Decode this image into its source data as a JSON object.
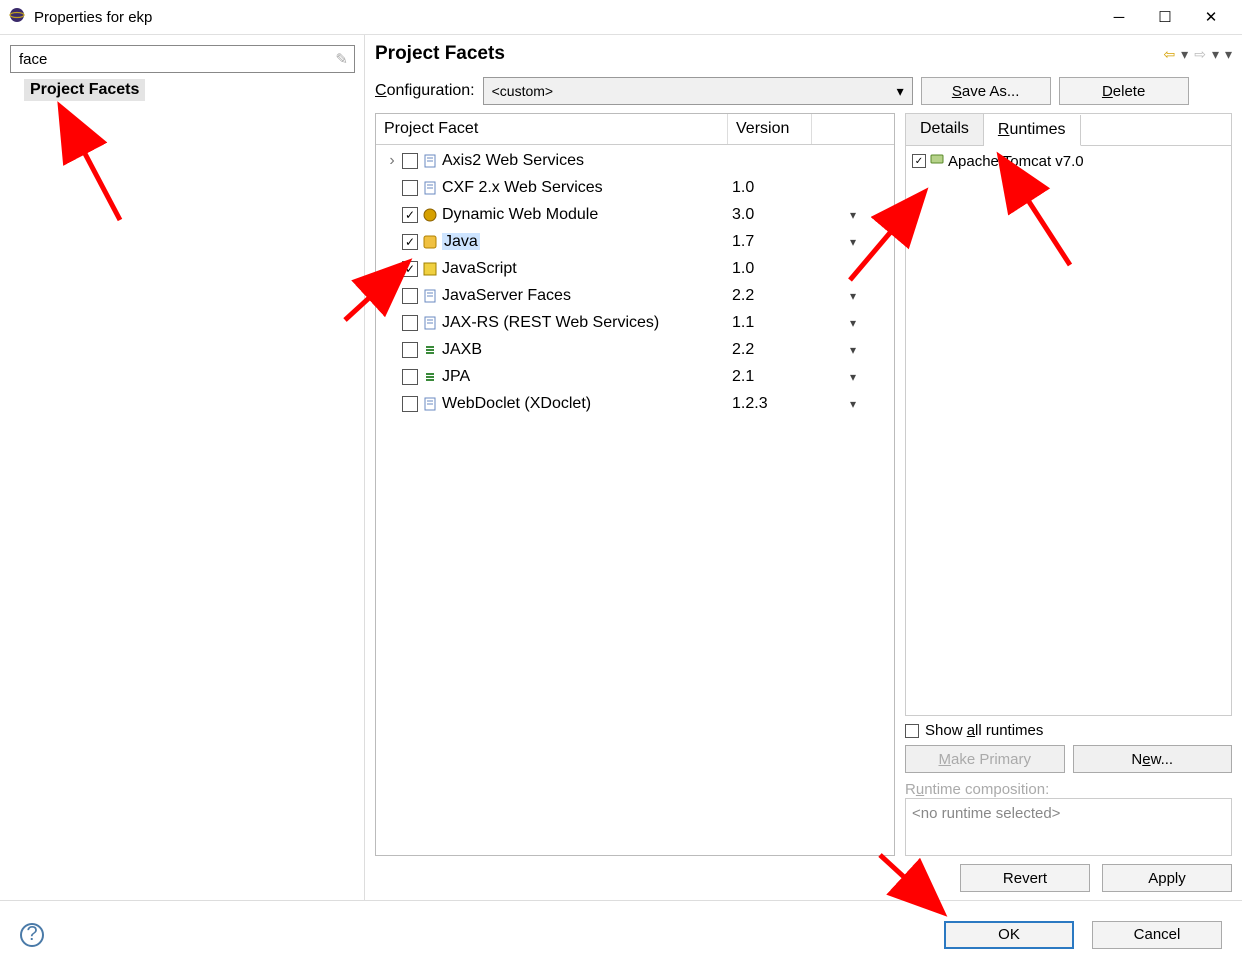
{
  "window": {
    "title": "Properties for ekp"
  },
  "left": {
    "filter_value": "face",
    "tree_item": "Project Facets"
  },
  "header": {
    "title": "Project Facets"
  },
  "config": {
    "label": "Configuration:",
    "value": "<custom>",
    "save_as": "Save As...",
    "delete": "Delete"
  },
  "facets": {
    "col_facet": "Project Facet",
    "col_version": "Version",
    "rows": [
      {
        "label": "Axis2 Web Services",
        "version": "",
        "checked": false,
        "expandable": true,
        "icon": "doc",
        "dropdown": false
      },
      {
        "label": "CXF 2.x Web Services",
        "version": "1.0",
        "checked": false,
        "expandable": false,
        "icon": "doc",
        "dropdown": false
      },
      {
        "label": "Dynamic Web Module",
        "version": "3.0",
        "checked": true,
        "expandable": false,
        "icon": "web",
        "dropdown": true
      },
      {
        "label": "Java",
        "version": "1.7",
        "checked": true,
        "expandable": false,
        "icon": "java",
        "dropdown": true,
        "selected": true
      },
      {
        "label": "JavaScript",
        "version": "1.0",
        "checked": true,
        "expandable": false,
        "icon": "js",
        "dropdown": false
      },
      {
        "label": "JavaServer Faces",
        "version": "2.2",
        "checked": false,
        "expandable": false,
        "icon": "doc",
        "dropdown": true
      },
      {
        "label": "JAX-RS (REST Web Services)",
        "version": "1.1",
        "checked": false,
        "expandable": false,
        "icon": "doc",
        "dropdown": true
      },
      {
        "label": "JAXB",
        "version": "2.2",
        "checked": false,
        "expandable": false,
        "icon": "link",
        "dropdown": true
      },
      {
        "label": "JPA",
        "version": "2.1",
        "checked": false,
        "expandable": false,
        "icon": "link",
        "dropdown": true
      },
      {
        "label": "WebDoclet (XDoclet)",
        "version": "1.2.3",
        "checked": false,
        "expandable": false,
        "icon": "doc",
        "dropdown": true
      }
    ]
  },
  "tabs": {
    "details": "Details",
    "runtimes": "Runtimes"
  },
  "runtimes": {
    "items": [
      {
        "label": "Apache Tomcat v7.0",
        "checked": true
      }
    ],
    "show_all_label": "Show all runtimes",
    "show_all_checked": false,
    "make_primary": "Make Primary",
    "new_btn": "New...",
    "composition_label": "Runtime composition:",
    "composition_value": "<no runtime selected>"
  },
  "bottom": {
    "revert": "Revert",
    "apply": "Apply"
  },
  "footer": {
    "ok": "OK",
    "cancel": "Cancel"
  }
}
